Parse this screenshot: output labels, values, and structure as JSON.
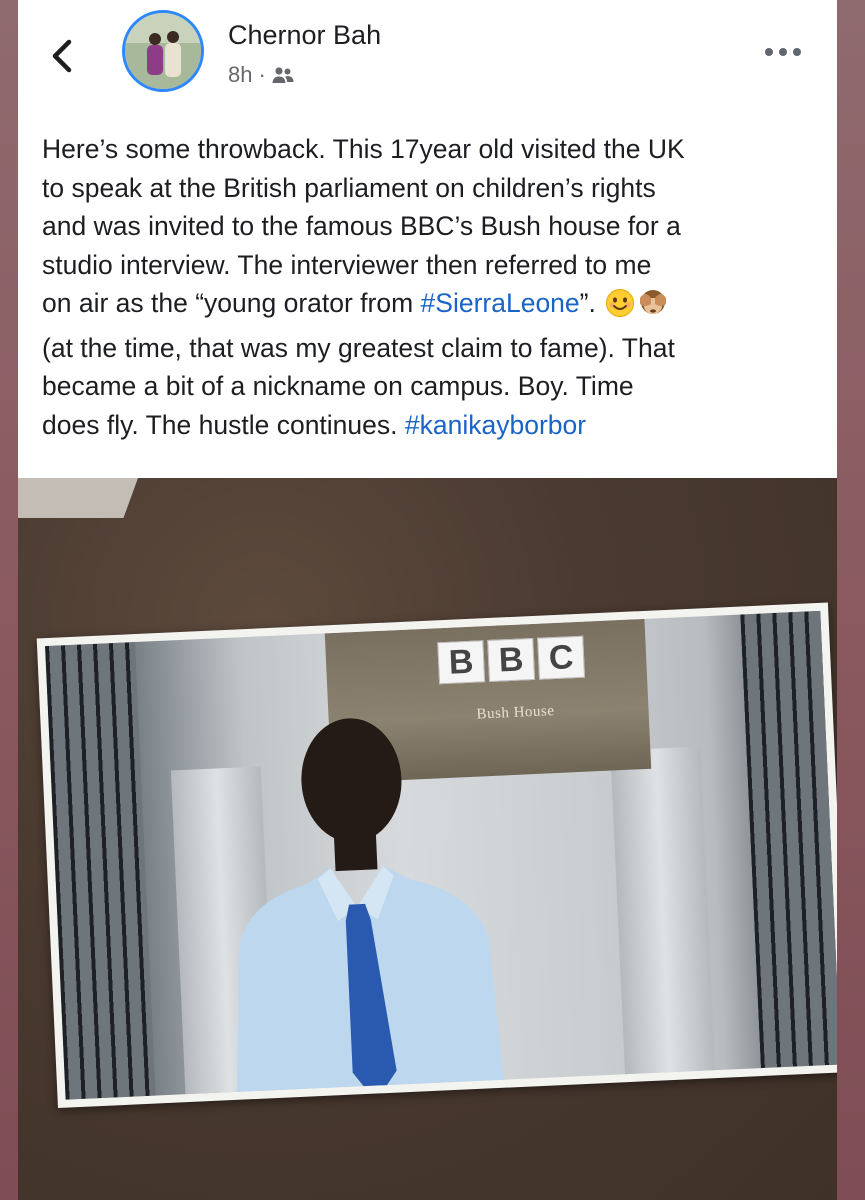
{
  "post": {
    "author_name": "Chernor Bah",
    "time_ago": "8h",
    "separator": "·",
    "audience_icon": "friends-icon",
    "back_icon": "chevron-left-icon",
    "more_icon": "more-dots-icon",
    "text_lines": [
      {
        "segments": [
          {
            "text": "Here’s some throwback. This 17year old visited the UK"
          }
        ]
      },
      {
        "segments": [
          {
            "text": "to speak at the British parliament on children’s rights"
          }
        ]
      },
      {
        "segments": [
          {
            "text": "and was invited to the famous BBC’s Bush house for a"
          }
        ]
      },
      {
        "segments": [
          {
            "text": "studio interview. The interviewer then referred to me"
          }
        ]
      },
      {
        "segments": [
          {
            "text": "on air as the “young orator from "
          },
          {
            "text": "#SierraLeone",
            "hashtag": true
          },
          {
            "text": "”. "
          }
        ],
        "emojis": [
          "smiling-face-emoji",
          "see-no-evil-monkey-emoji"
        ]
      },
      {
        "segments": [
          {
            "text": "(at the time, that was my greatest claim to fame). That"
          }
        ]
      },
      {
        "segments": [
          {
            "text": "became a bit of a nickname on campus. Boy. Time"
          }
        ]
      },
      {
        "segments": [
          {
            "text": "does fly. The hustle continues. "
          },
          {
            "text": "#kanikayborbor",
            "hashtag": true
          }
        ]
      }
    ],
    "hashtag_color": "#1a64c8"
  },
  "photo": {
    "logo_letters": [
      "B",
      "B",
      "C"
    ],
    "sign_text": "Bush House"
  },
  "colors": {
    "card_bg": "#ffffff",
    "text": "#1c1e21",
    "meta": "#65676b",
    "avatar_ring": "#2d88ff"
  }
}
